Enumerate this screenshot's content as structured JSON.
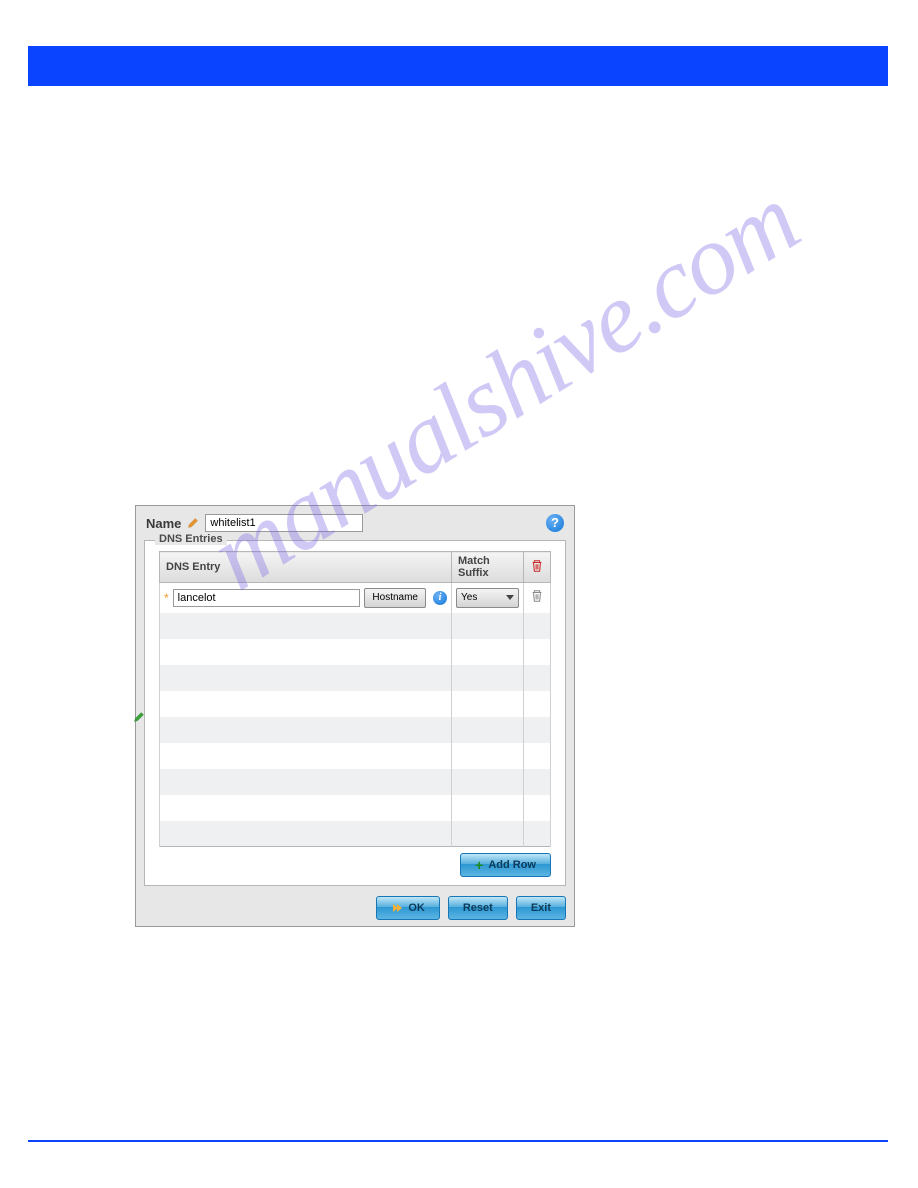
{
  "watermark": "manualshive.com",
  "panel": {
    "name_label": "Name",
    "name_value": "whitelist1",
    "help_glyph": "?",
    "fieldset_legend": "DNS Entries",
    "headers": {
      "entry": "DNS Entry",
      "suffix": "Match Suffix"
    },
    "row": {
      "star": "*",
      "entry_value": "lancelot",
      "type_button": "Hostname",
      "info_glyph": "i",
      "suffix_value": "Yes"
    },
    "add_row_label": "Add Row",
    "buttons": {
      "ok": "OK",
      "reset": "Reset",
      "exit": "Exit"
    }
  }
}
